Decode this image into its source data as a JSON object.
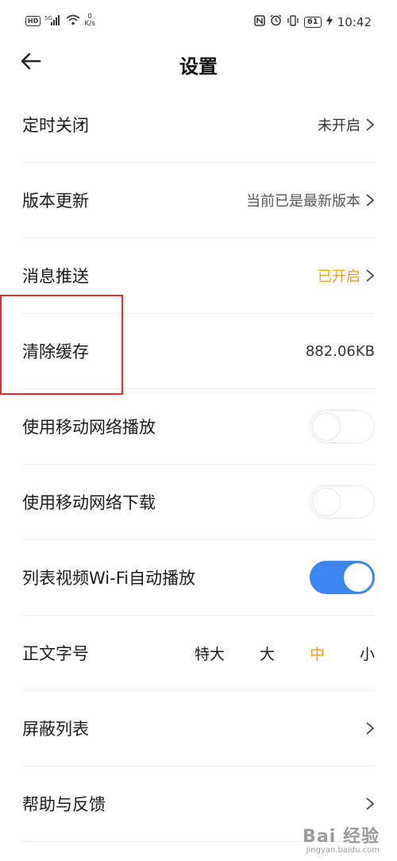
{
  "statusbar": {
    "hd": "HD",
    "signal": "5G",
    "net_speed_value": "0",
    "net_speed_unit": "K/s",
    "battery": "61",
    "time": "10:42"
  },
  "header": {
    "title": "设置"
  },
  "settings": {
    "timer_close": {
      "label": "定时关闭",
      "value": "未开启"
    },
    "version_update": {
      "label": "版本更新",
      "value": "当前已是最新版本"
    },
    "push": {
      "label": "消息推送",
      "value": "已开启"
    },
    "clear_cache": {
      "label": "清除缓存",
      "value": "882.06KB"
    },
    "mobile_play": {
      "label": "使用移动网络播放",
      "enabled": false
    },
    "mobile_download": {
      "label": "使用移动网络下载",
      "enabled": false
    },
    "wifi_autoplay": {
      "label": "列表视频Wi-Fi自动播放",
      "enabled": true
    },
    "font_size": {
      "label": "正文字号",
      "options": [
        "特大",
        "大",
        "中",
        "小"
      ],
      "selected": "中"
    },
    "block_list": {
      "label": "屏蔽列表"
    },
    "help": {
      "label": "帮助与反馈"
    }
  },
  "colors": {
    "accent": "#3d86f0",
    "highlight_text": "#e4a01c",
    "annotation": "#e0302a"
  },
  "watermark": {
    "main": "Bai 经验",
    "sub": "jingyan.baidu.com"
  }
}
